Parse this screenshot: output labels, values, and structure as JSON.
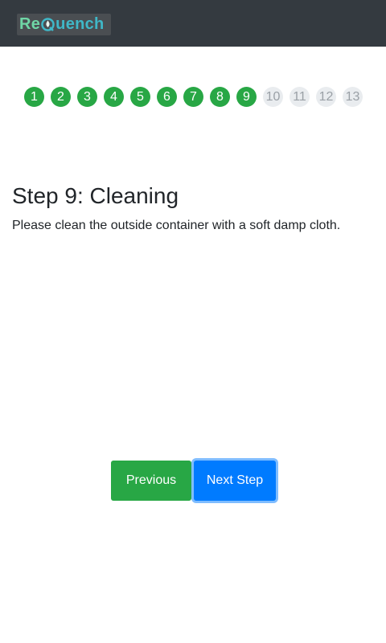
{
  "header": {
    "logo_text": "ReQuench",
    "logo_part_a": "Re",
    "logo_part_b": "uench"
  },
  "stepper": {
    "current": 9,
    "steps": [
      {
        "label": "1",
        "status": "done"
      },
      {
        "label": "2",
        "status": "done"
      },
      {
        "label": "3",
        "status": "done"
      },
      {
        "label": "4",
        "status": "done"
      },
      {
        "label": "5",
        "status": "done"
      },
      {
        "label": "6",
        "status": "done"
      },
      {
        "label": "7",
        "status": "done"
      },
      {
        "label": "8",
        "status": "done"
      },
      {
        "label": "9",
        "status": "current"
      },
      {
        "label": "10",
        "status": "pending"
      },
      {
        "label": "11",
        "status": "pending"
      },
      {
        "label": "12",
        "status": "pending"
      },
      {
        "label": "13",
        "status": "pending"
      }
    ]
  },
  "content": {
    "title": "Step 9: Cleaning",
    "description": "Please clean the outside container with a soft damp cloth."
  },
  "buttons": {
    "previous_label": "Previous",
    "next_label": "Next Step"
  },
  "colors": {
    "navbar": "#343a40",
    "step_done": "#28a745",
    "step_pending": "#e9ecef",
    "previous_button": "#28a745",
    "next_button": "#007bff"
  }
}
